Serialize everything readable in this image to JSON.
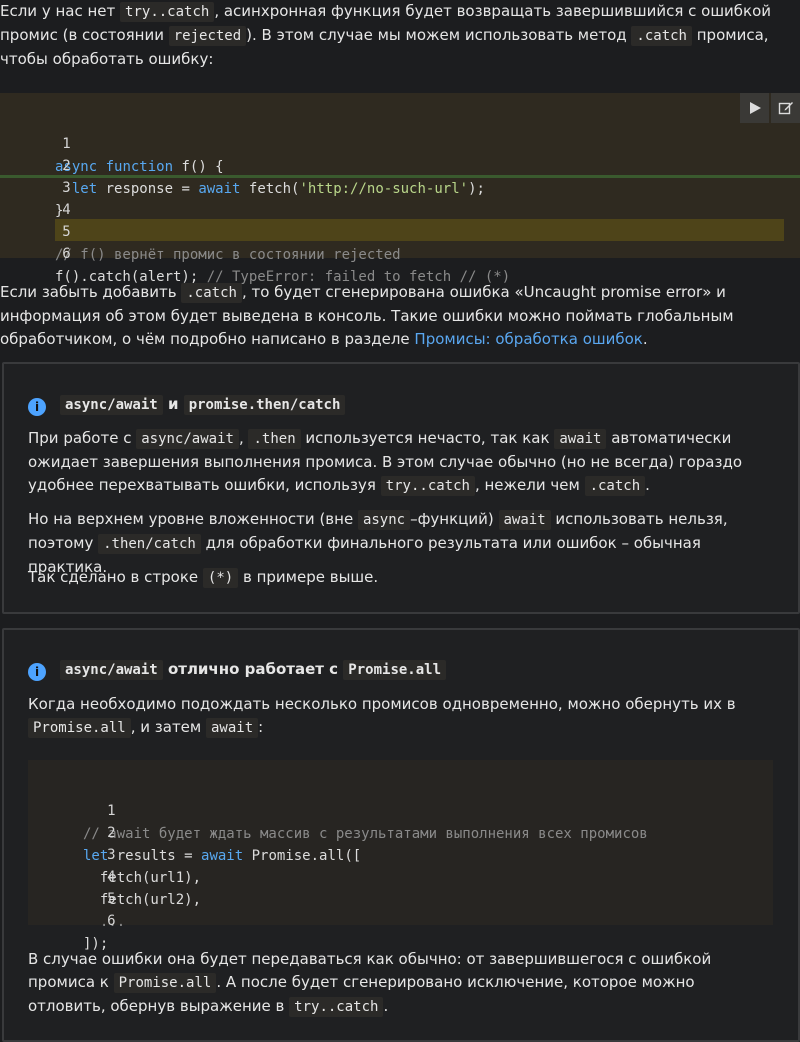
{
  "intro": {
    "t1": "Если у нас нет ",
    "c1": "try..catch",
    "t2": ", асинхронная функция будет возвращать завершившийся с ошибкой промис (в состоянии ",
    "c2": "rejected",
    "t3": "). В этом случае мы можем использовать метод ",
    "c3": ".catch",
    "t4": " промиса, чтобы обработать ошибку:"
  },
  "code1": {
    "lines": [
      {
        "num": "1",
        "a": "async",
        "b": " ",
        "c": "function",
        "d": " f() {"
      },
      {
        "num": "2",
        "a": "  let",
        "b": " response = ",
        "c": "await",
        "d": " fetch(",
        "s": "'http://no-such-url'",
        "e": ");"
      },
      {
        "num": "3",
        "text": "}"
      },
      {
        "num": "4",
        "text": ""
      },
      {
        "num": "5",
        "comment": "// f() вернёт промис в состоянии rejected"
      },
      {
        "num": "6",
        "text": "f().catch(alert); ",
        "comment": "// TypeError: failed to fetch // (*)"
      }
    ],
    "run_icon": "play-icon",
    "edit_icon": "edit-icon"
  },
  "para2": {
    "t1": "Если забыть добавить ",
    "c1": ".catch",
    "t2": ", то будет сгенерирована ошибка «Uncaught promise error» и информация об этом будет выведена в консоль. Такие ошибки можно поймать глобальным обработчиком, о чём подробно написано в разделе ",
    "link": "Промисы: обработка ошибок",
    "t3": "."
  },
  "note1": {
    "icon": "info-icon",
    "h_c1": "async/await",
    "h_t": " и ",
    "h_c2": "promise.then/catch",
    "p1": {
      "t1": "При работе с ",
      "c1": "async/await",
      "t2": ", ",
      "c2": ".then",
      "t3": " используется нечасто, так как ",
      "c3": "await",
      "t4": " автоматически ожидает завершения выполнения промиса. В этом случае обычно (но не всегда) гораздо удобнее перехватывать ошибки, используя ",
      "c4": "try..catch",
      "t5": ", нежели чем ",
      "c5": ".catch",
      "t6": "."
    },
    "p2": {
      "t1": "Но на верхнем уровне вложенности (вне ",
      "c1": "async",
      "t2": "–функций) ",
      "c2": "await",
      "t3": " использовать нельзя, поэтому ",
      "c3": ".then/catch",
      "t4": " для обработки финального результата или ошибок – обычная практика."
    },
    "p3": {
      "t1": "Так сделано в строке ",
      "c1": "(*)",
      "t2": " в примере выше."
    }
  },
  "note2": {
    "icon": "info-icon",
    "h_c1": "async/await",
    "h_t": " отлично работает с ",
    "h_c2": "Promise.all",
    "p1": {
      "t1": "Когда необходимо подождать несколько промисов одновременно, можно обернуть их в ",
      "c1": "Promise.all",
      "t2": ", и затем ",
      "c2": "await",
      "t3": ":"
    },
    "code": [
      {
        "num": "1",
        "comment": "// await будет ждать массив с результатами выполнения всех промисов"
      },
      {
        "num": "2",
        "a": "let",
        "b": " results = ",
        "c": "await",
        "d": " Promise.all(["
      },
      {
        "num": "3",
        "text": "  fetch(url1),"
      },
      {
        "num": "4",
        "text": "  fetch(url2),"
      },
      {
        "num": "5",
        "comment": "  ..."
      },
      {
        "num": "6",
        "text": "]);"
      }
    ],
    "p2": {
      "t1": "В случае ошибки она будет передаваться как обычно: от завершившегося с ошибкой промиса к ",
      "c1": "Promise.all",
      "t2": ". А после будет сгенерировано исключение, которое можно отловить, обернув выражение в ",
      "c2": "try..catch",
      "t3": "."
    }
  }
}
